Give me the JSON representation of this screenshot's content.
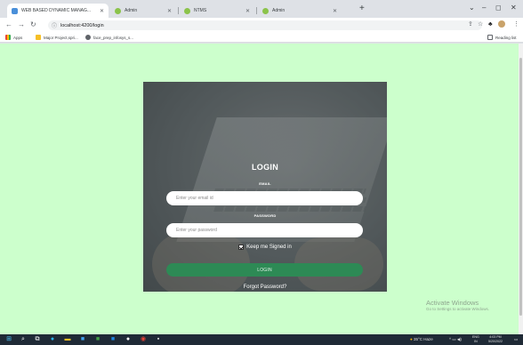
{
  "browser": {
    "tabs": [
      {
        "title": "WEB BASED DYNAMIC MANAG...",
        "favicon_color": "#4a8fd9",
        "active": true
      },
      {
        "title": "Admin",
        "favicon_color": "#8bc34a",
        "active": false
      },
      {
        "title": "NTMS",
        "favicon_color": "#8bc34a",
        "active": false
      },
      {
        "title": "Admin",
        "favicon_color": "#8bc34a",
        "active": false
      }
    ],
    "new_tab_glyph": "+",
    "window_controls": [
      "⌄",
      "–",
      "◻",
      "✕"
    ],
    "url": "localhost:4200/login",
    "bookmarks": {
      "apps_label": "Apps",
      "items": [
        {
          "label": "Major Project,spri...",
          "icon": "folder-icon"
        },
        {
          "label": "face_prep_infosys_s...",
          "icon": "web-icon"
        }
      ],
      "reading_list_label": "Reading list"
    }
  },
  "login": {
    "title": "LOGIN",
    "email_label": "EMAIL",
    "email_placeholder": "Enter your email id",
    "password_label": "PASSWORD",
    "password_placeholder": "Enter your password",
    "keep_signed_in_label": "Keep me Signed in",
    "keep_signed_in_checked": true,
    "login_button_label": "LOGIN",
    "forgot_password_label": "Forgot Password?"
  },
  "watermark": {
    "title": "Activate Windows",
    "subtitle": "Go to Settings to activate Windows."
  },
  "taskbar": {
    "weather": "35°C Haze",
    "language": "ENG",
    "language_sub": "IN",
    "time": "4:03 PM",
    "date": "5/20/2022"
  },
  "colors": {
    "page_background": "#ccffcc",
    "login_button": "#2d8a55"
  }
}
